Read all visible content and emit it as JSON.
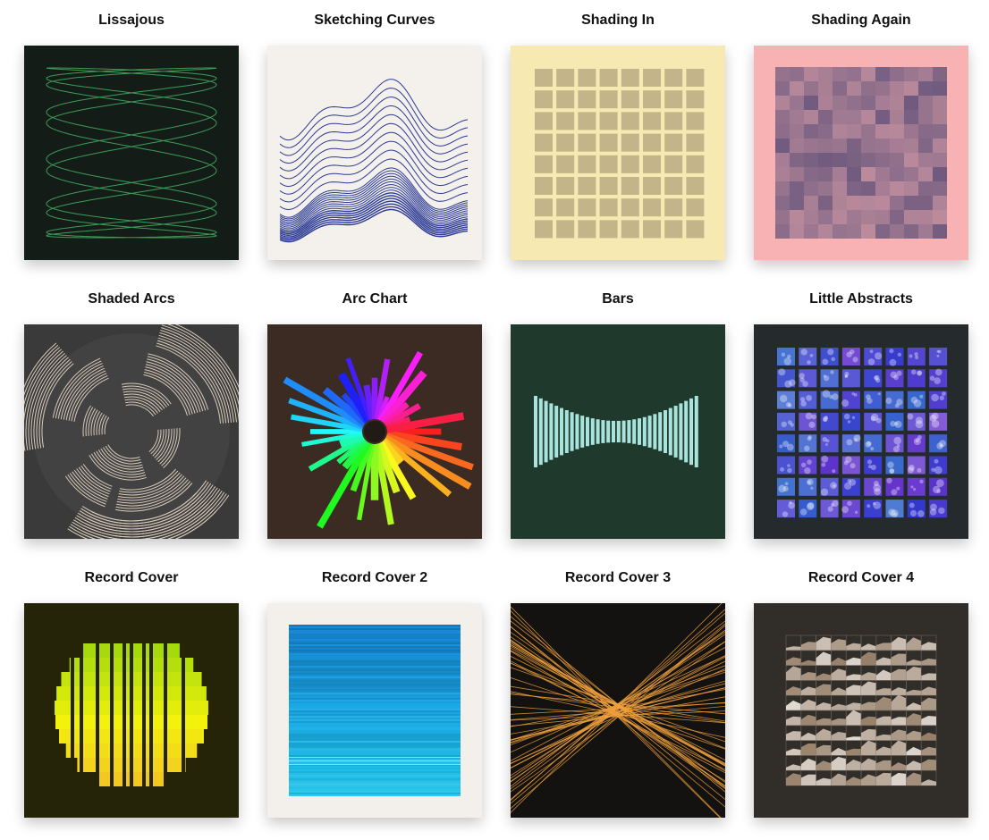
{
  "gallery": {
    "items": [
      {
        "title": "Lissajous",
        "art": "lissajous",
        "bg": "#141c17",
        "fg": "#3fa25c"
      },
      {
        "title": "Sketching Curves",
        "art": "curves",
        "bg": "#f4f0ec",
        "fg": "#2b3a94"
      },
      {
        "title": "Shading In",
        "art": "shading-grid",
        "bg": "#f6e9b2",
        "fg": "#c4b48a"
      },
      {
        "title": "Shading Again",
        "art": "shading-again",
        "bg": "#f9b2b4",
        "fg": "#6e5a7e"
      },
      {
        "title": "Shaded Arcs",
        "art": "arcs",
        "bg": "#3a3a3a",
        "fg": "#d9cbb9"
      },
      {
        "title": "Arc Chart",
        "art": "arc-chart",
        "bg": "#3c2b22",
        "fg": "#ff2a6d"
      },
      {
        "title": "Bars",
        "art": "bars",
        "bg": "#1f3a2c",
        "fg": "#a9e3dd"
      },
      {
        "title": "Little Abstracts",
        "art": "abstracts",
        "bg": "#252b2d",
        "fg": "#4a63cf"
      },
      {
        "title": "Record Cover",
        "art": "record1",
        "bg": "#262408",
        "fg": "#a6e11b"
      },
      {
        "title": "Record Cover 2",
        "art": "record2",
        "bg": "#f3efeb",
        "fg": "#1463b5"
      },
      {
        "title": "Record Cover 3",
        "art": "record3",
        "bg": "#141210",
        "fg": "#f2a23c"
      },
      {
        "title": "Record Cover 4",
        "art": "record4",
        "bg": "#312d29",
        "fg": "#c9b8a6"
      }
    ]
  }
}
